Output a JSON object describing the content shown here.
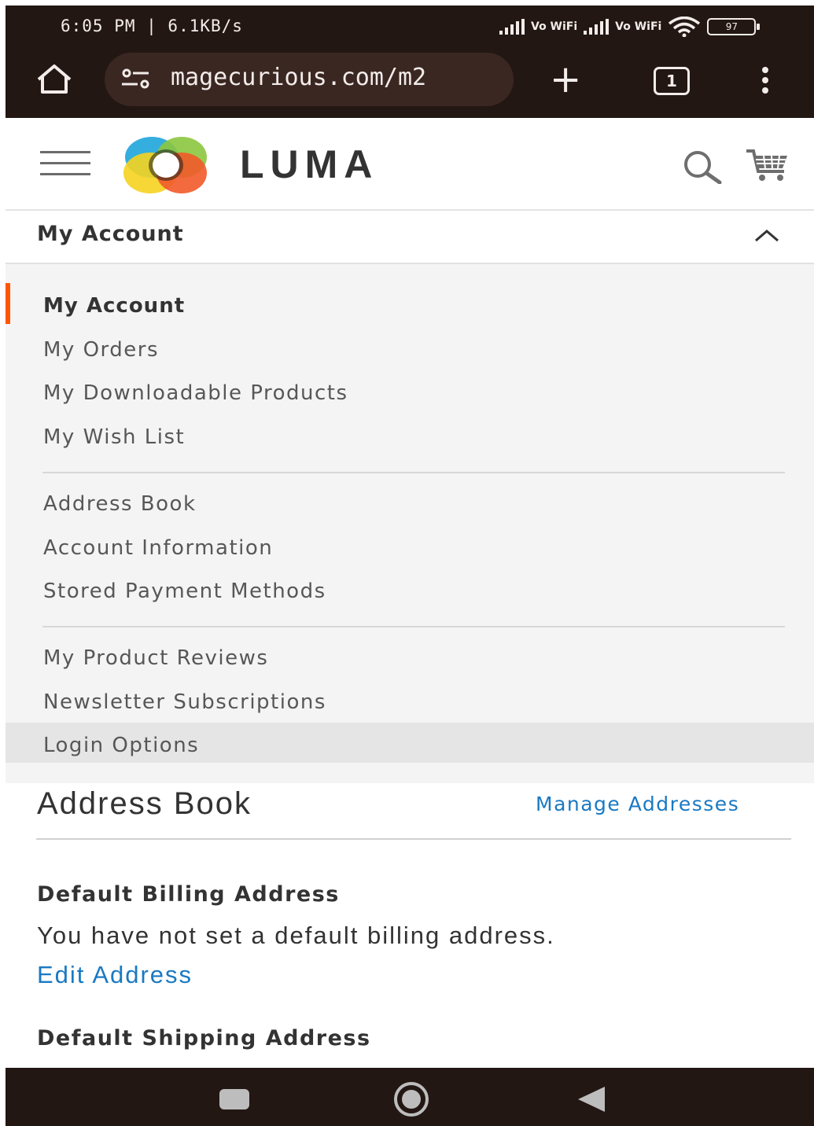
{
  "status_bar": {
    "time_speed": "6:05 PM | 6.1KB/s",
    "vowifi_1": "Vo WiFi",
    "vowifi_2": "Vo WiFi",
    "battery": "97"
  },
  "browser": {
    "url": "magecurious.com/m2",
    "tab_count": "1"
  },
  "site": {
    "logo_text": "LUMA"
  },
  "account_menu": {
    "title": "My Account",
    "items": [
      {
        "label": "My Account",
        "current": true
      },
      {
        "label": "My Orders"
      },
      {
        "label": "My Downloadable Products"
      },
      {
        "label": "My Wish List"
      },
      {
        "label": "Address Book"
      },
      {
        "label": "Account Information"
      },
      {
        "label": "Stored Payment Methods"
      },
      {
        "label": "My Product Reviews"
      },
      {
        "label": "Newsletter Subscriptions"
      },
      {
        "label": "Login Options",
        "hovered": true
      }
    ]
  },
  "address_book": {
    "title": "Address Book",
    "manage_link": "Manage Addresses",
    "billing": {
      "title": "Default Billing Address",
      "text": "You have not set a default billing address.",
      "edit_link": "Edit Address"
    },
    "shipping": {
      "title": "Default Shipping Address"
    }
  },
  "colors": {
    "accent": "#ff5501",
    "link": "#1979c3",
    "browser_bar": "#231713"
  },
  "icons": [
    "home-icon",
    "site-info-icon",
    "plus-icon",
    "tabs-icon",
    "more-icon",
    "menu-icon",
    "search-icon",
    "cart-icon",
    "chevron-up-icon",
    "android-recents-icon",
    "android-home-icon",
    "android-back-icon"
  ]
}
